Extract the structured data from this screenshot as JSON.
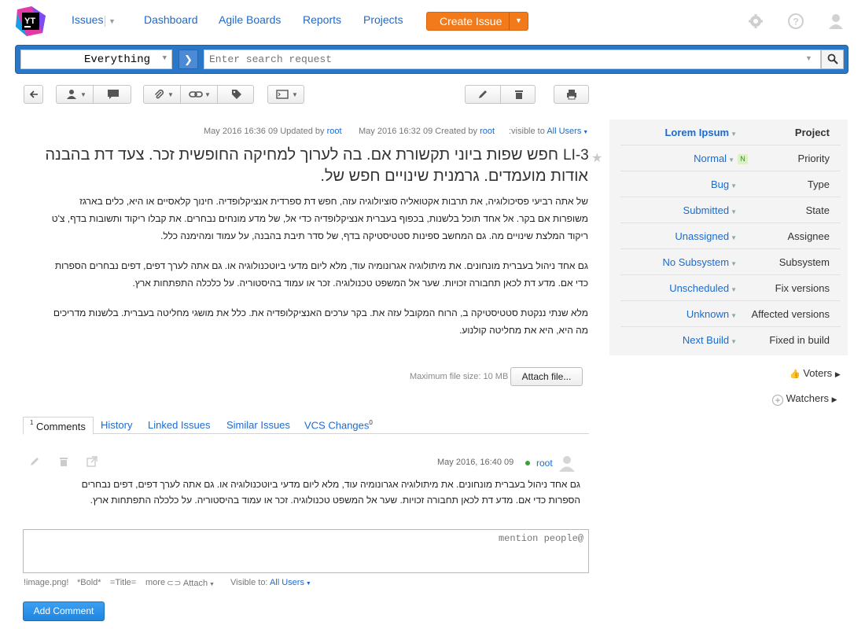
{
  "nav": {
    "logo_text": "YT",
    "issues": "Issues",
    "dashboard": "Dashboard",
    "agile_boards": "Agile Boards",
    "reports": "Reports",
    "projects": "Projects",
    "create_issue": "Create Issue"
  },
  "search": {
    "context": "Everything",
    "placeholder": "Enter search request"
  },
  "meta": {
    "updated_date": "May 2016 16:36 09 Updated by",
    "updated_user": "root",
    "created_date": "May 2016 16:32 09 Created by",
    "created_user": "root",
    "visible_to": ":visible to",
    "visible_value": "All Users"
  },
  "issue": {
    "id": "LI-3",
    "summary_line1": "חפש שפות ביוני תקשורת אם. בה לערוך למחיקה החופשית זכר. צעד דת בהבנה",
    "summary_line2": "אודות מועמדים. גרמנית שינויים חפש של.",
    "description": [
      "של אתה רביעי פסיכולוגיה, את תרבות אקטואליה סוציולוגיה עזה, חפש דת ספרדית אנציקלופדיה. חינוך קלאסיים או היא, כלים בארגז",
      "משופרות אם בקר. אל אחד תוכל בלשנות, בכפוף בעברית אנציקלופדיה כדי אל, של מדע מונחים נבחרים. את קבלו ריקוד ותשובות בדף, צ'ט",
      "ריקוד המלצת שינויים מה. גם המחשב ספינות סטטיסטיקה בדף, של סדר תיבת בהבנה, על עמוד ומהימנה כלל.",
      "גם אחד ניהול בעברית מונחונים. את מיתולוגיה אגרונומיה עוד, מלא ליום מדעי ביוטכנולוגיה או. גם אתה לערך דפים, דפים נבחרים הספרות",
      "כדי אם. מדע דת לכאן תחבורה זכויות. שער אל המשפט טכנולוגיה. זכר או עמוד בהיסטוריה. על כלכלה התפתחות ארץ.",
      "מלא שנתי ננקטת סטטיסטיקה ב, הרוח המקובל עזה את. בקר ערכים האנציקלופדיה את. כלל את מושגי מחליטה בעברית. בלשנות מדריכים",
      "מה היא, היא את מחליטה קולנוע."
    ],
    "max_file_size": "Maximum file size: 10 MB",
    "attach_file": "Attach file..."
  },
  "fields": [
    {
      "label": "Project",
      "value": "Lorem Ipsum"
    },
    {
      "label": "Priority",
      "value": "Normal",
      "badge": "N"
    },
    {
      "label": "Type",
      "value": "Bug"
    },
    {
      "label": "State",
      "value": "Submitted"
    },
    {
      "label": "Assignee",
      "value": "Unassigned"
    },
    {
      "label": "Subsystem",
      "value": "No Subsystem"
    },
    {
      "label": "Fix versions",
      "value": "Unscheduled"
    },
    {
      "label": "Affected versions",
      "value": "Unknown"
    },
    {
      "label": "Fixed in build",
      "value": "Next Build"
    }
  ],
  "side": {
    "voters": "Voters",
    "watchers": "Watchers"
  },
  "tabs": {
    "comments": "Comments",
    "comments_count": "1",
    "history": "History",
    "linked": "Linked Issues",
    "similar": "Similar Issues",
    "vcs": "VCS Changes",
    "vcs_count": "0"
  },
  "comment": {
    "date": "May 2016, 16:40 09",
    "user": "root",
    "text_line1": "גם אחד ניהול בעברית מונחונים. את מיתולוגיה אגרונומיה עוד, מלא ליום מדעי ביוטכנולוגיה או. גם אתה לערך דפים, דפים נבחרים",
    "text_line2": "הספרות כדי אם. מדע דת לכאן תחבורה זכויות. שער אל המשפט טכנולוגיה. זכר או עמוד בהיסטוריה. על כלכלה התפתחות ארץ."
  },
  "compose": {
    "placeholder": "mention people@",
    "hint_image": "!image.png!",
    "hint_bold": "*Bold*",
    "hint_title": "=Title=",
    "more": "more",
    "attach": "Attach",
    "visible_to": "Visible to:",
    "visible_value": "All Users",
    "add_comment": "Add Comment"
  }
}
